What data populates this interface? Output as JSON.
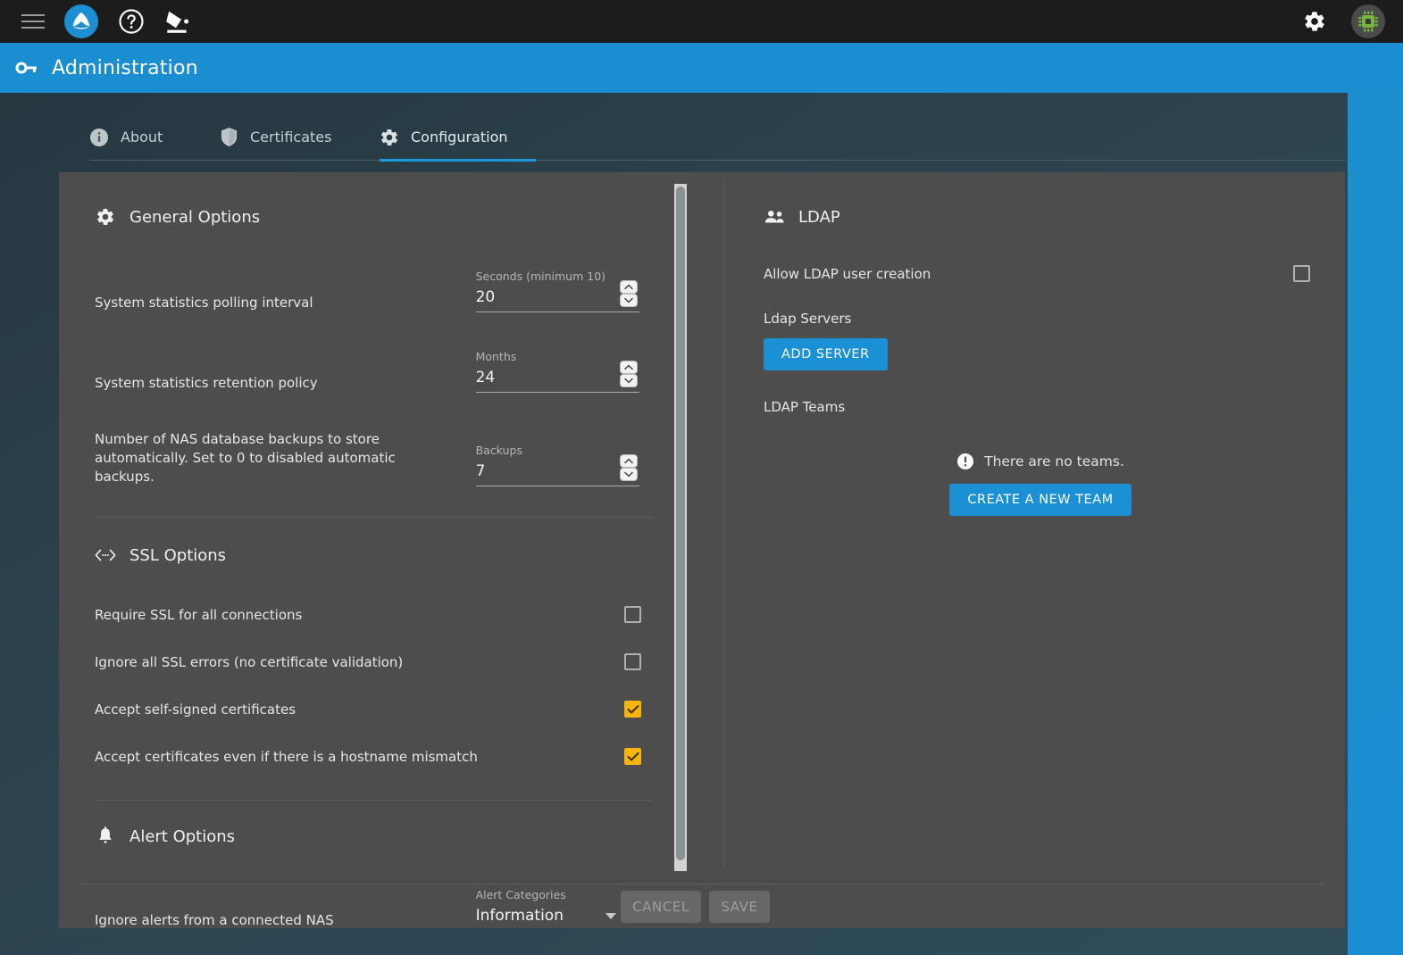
{
  "topbar": {
    "menu_icon": "hamburger-icon",
    "logo_icon": "app-logo-icon",
    "help_icon": "help-circle-icon",
    "theme_icon": "paint-bucket-icon",
    "settings_icon": "gear-icon",
    "avatar_icon": "user-avatar-chip-icon"
  },
  "titlebar": {
    "icon": "key-icon",
    "title": "Administration"
  },
  "tabs": [
    {
      "label": "About",
      "icon": "info-icon",
      "active": false
    },
    {
      "label": "Certificates",
      "icon": "shield-icon",
      "active": false
    },
    {
      "label": "Configuration",
      "icon": "gear-icon",
      "active": true
    }
  ],
  "general": {
    "heading": "General Options",
    "heading_icon": "gear-icon",
    "rows": [
      {
        "label": "System statistics polling interval",
        "caption": "Seconds (minimum 10)",
        "value": "20"
      },
      {
        "label": "System statistics retention policy",
        "caption": "Months",
        "value": "24"
      },
      {
        "label": "Number of NAS database backups to store automatically. Set to 0 to disabled automatic backups.",
        "caption": "Backups",
        "value": "7"
      }
    ]
  },
  "ssl": {
    "heading": "SSL Options",
    "heading_icon": "code-arrows-icon",
    "rows": [
      {
        "label": "Require SSL for all connections",
        "checked": false
      },
      {
        "label": "Ignore all SSL errors (no certificate validation)",
        "checked": false
      },
      {
        "label": "Accept self-signed certificates",
        "checked": true
      },
      {
        "label": "Accept certificates even if there is a hostname mismatch",
        "checked": true
      }
    ]
  },
  "alerts": {
    "heading": "Alert Options",
    "heading_icon": "bell-icon",
    "row_label": "Ignore alerts from a connected NAS",
    "select_caption": "Alert Categories",
    "select_value": "Information"
  },
  "ldap": {
    "heading": "LDAP",
    "heading_icon": "people-icon",
    "allow_creation_label": "Allow LDAP user creation",
    "allow_creation_checked": false,
    "servers_label": "Ldap Servers",
    "add_server_label": "ADD SERVER",
    "teams_label": "LDAP Teams",
    "empty_icon": "exclamation-circle-icon",
    "empty_text": "There are no teams.",
    "create_team_label": "CREATE A NEW TEAM"
  },
  "footer": {
    "cancel_label": "CANCEL",
    "save_label": "SAVE"
  },
  "colors": {
    "accent_blue": "#1b8ed2",
    "checkbox_checked": "#f5b50c",
    "panel_bg": "#4d4d4d",
    "topbar_bg": "#1c1c1c"
  }
}
